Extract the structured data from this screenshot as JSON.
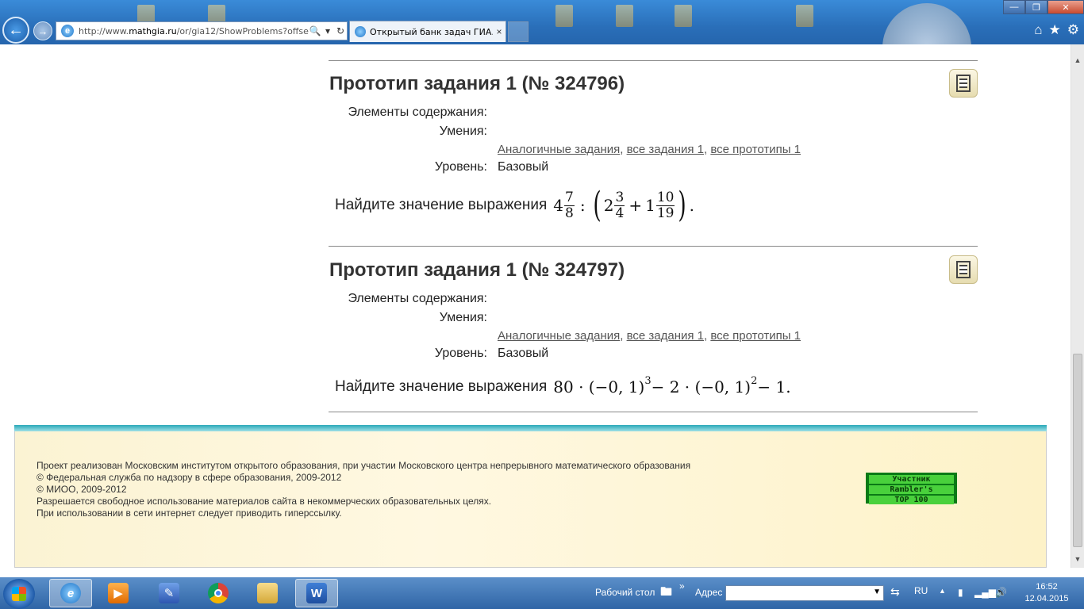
{
  "browser": {
    "url_prefix": "http://www.",
    "url_domain": "mathgia.ru",
    "url_rest": "/or/gia12/ShowProblems?offse",
    "tab_title": "Открытый банк задач ГИА...",
    "tab_close": "×",
    "back_glyph": "←",
    "forward_glyph": "→",
    "search_glyph": "🔍",
    "dropdown_glyph": "▾",
    "refresh_glyph": "↻",
    "minimize": "—",
    "restore": "❐",
    "close": "✕",
    "home_glyph": "⌂",
    "favorites_glyph": "★",
    "settings_glyph": "⚙"
  },
  "problems": [
    {
      "title": "Прототип задания 1 (№ 324796)",
      "content_label": "Элементы содержания:",
      "skills_label": "Умения:",
      "link_similar": "Аналогичные задания",
      "link_all_tasks": "все задания 1",
      "link_all_prototypes": "все прототипы 1",
      "sep1": ", ",
      "sep2": ", ",
      "level_label": "Уровень:",
      "level_value": "Базовый",
      "task_text": "Найдите значение выражения"
    },
    {
      "title": "Прототип задания 1 (№ 324797)",
      "content_label": "Элементы содержания:",
      "skills_label": "Умения:",
      "link_similar": "Аналогичные задания",
      "link_all_tasks": "все задания 1",
      "link_all_prototypes": "все прототипы 1",
      "sep1": ", ",
      "sep2": ", ",
      "level_label": "Уровень:",
      "level_value": "Базовый",
      "task_text": "Найдите значение выражения"
    }
  ],
  "math1": {
    "whole1": "4",
    "num1": "7",
    "den1": "8",
    "colon": ":",
    "whole2": "2",
    "num2": "3",
    "den2": "4",
    "plus": "+",
    "whole3": "1",
    "num3": "10",
    "den3": "19",
    "end": "."
  },
  "math2": {
    "a": "80 · (−0, 1)",
    "exp1": "3",
    "b": " − 2 · (−0, 1)",
    "exp2": "2",
    "c": " − 1",
    "end": "."
  },
  "footer": {
    "line1": "Проект реализован Московским институтом открытого образования, при участии Московского центра непрерывного математического образования",
    "line2": "© Федеральная служба по надзору в сфере образования, 2009-2012",
    "line3": "© МИОО, 2009-2012",
    "line4": "Разрешается свободное использование материалов сайта в некоммерческих образовательных целях.",
    "line5": "При использовании в сети интернет следует приводить гиперссылку.",
    "rambler1": "Участник",
    "rambler2": "Rambler's",
    "rambler3": "TOP 100"
  },
  "taskbar": {
    "desktop_label": "Рабочий стол",
    "chevron": "»",
    "address_label": "Адрес",
    "lang": "RU",
    "time": "16:52",
    "date": "12.04.2015",
    "word_letter": "W",
    "ie_letter": "e"
  }
}
